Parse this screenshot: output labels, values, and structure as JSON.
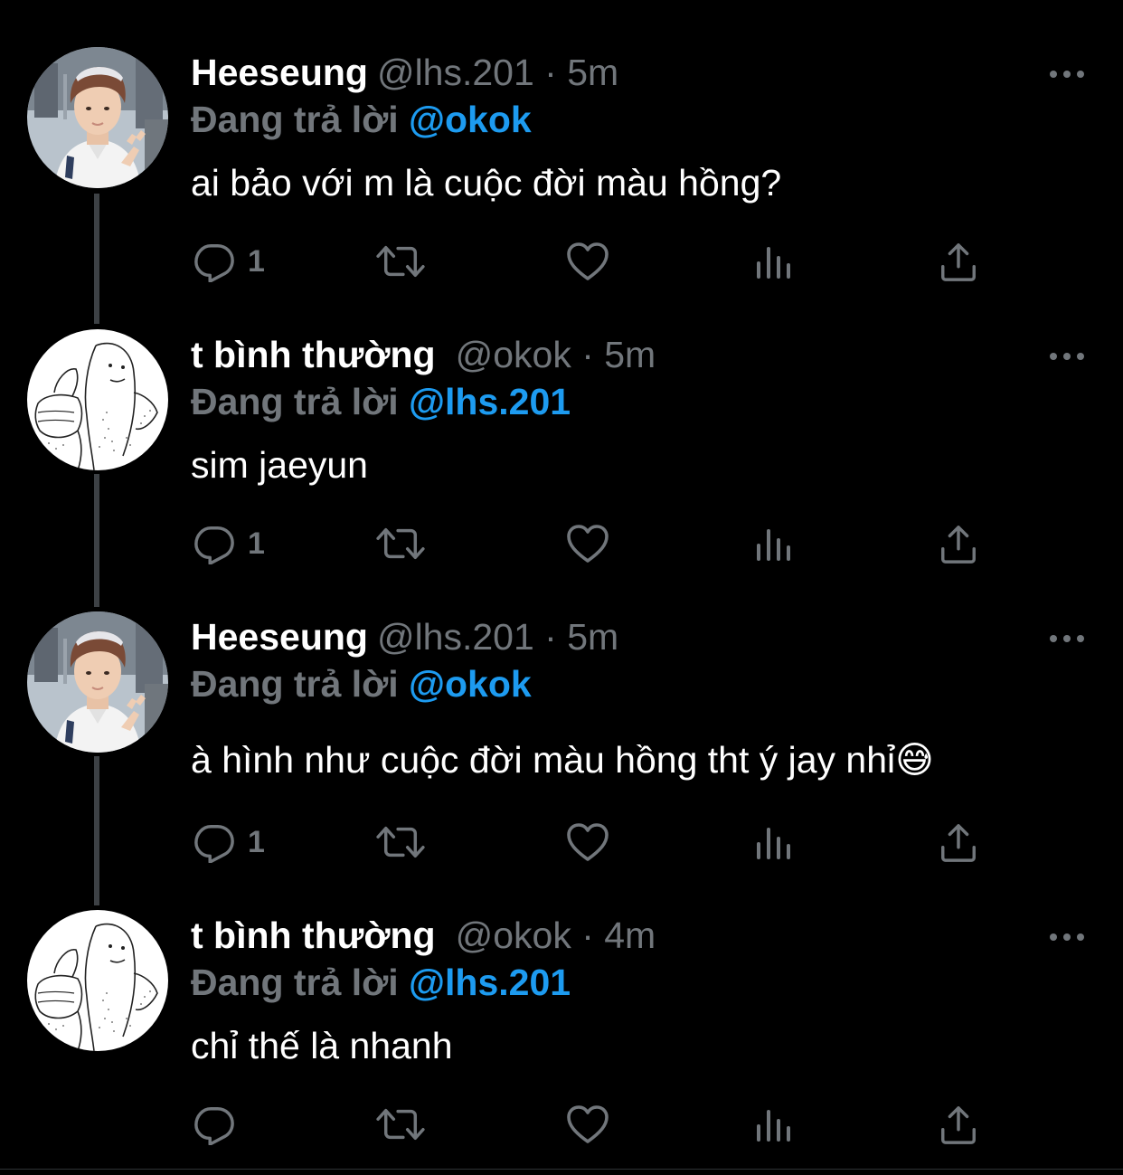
{
  "colors": {
    "background": "#000000",
    "text_primary": "#ffffff",
    "text_secondary": "#71767b",
    "link": "#1d9bf0",
    "thread_line": "#3d4145"
  },
  "tweets": [
    {
      "name": "Heeseung",
      "handle_time": "@lhs.201 · 5m",
      "reply_label": "Đang trả lời",
      "reply_target": "@okok",
      "text": "ai bảo với m là cuộc đời màu hồng?",
      "reply_count": "1",
      "avatar_icon": "selfie-photo-avatar"
    },
    {
      "name": "t bình thường",
      "handle_time": "@okok · 5m",
      "reply_label": "Đang trả lời",
      "reply_target": "@lhs.201",
      "text": "sim jaeyun",
      "reply_count": "1",
      "avatar_icon": "thumbs-up-doodle-avatar"
    },
    {
      "name": "Heeseung",
      "handle_time": "@lhs.201 · 5m",
      "reply_label": "Đang trả lời",
      "reply_target": "@okok",
      "text": "à hình như cuộc đời màu hồng tht ý jay nhỉ",
      "emoji": "😅",
      "reply_count": "1",
      "avatar_icon": "selfie-photo-avatar"
    },
    {
      "name": "t bình thường",
      "handle_time": "@okok · 4m",
      "reply_label": "Đang trả lời",
      "reply_target": "@lhs.201",
      "text": "chỉ thế là nhanh",
      "reply_count": "",
      "avatar_icon": "thumbs-up-doodle-avatar"
    }
  ],
  "action_icons": [
    "reply-icon",
    "retweet-icon",
    "like-icon",
    "analytics-icon",
    "share-icon"
  ],
  "more_icon": "more-options-icon"
}
